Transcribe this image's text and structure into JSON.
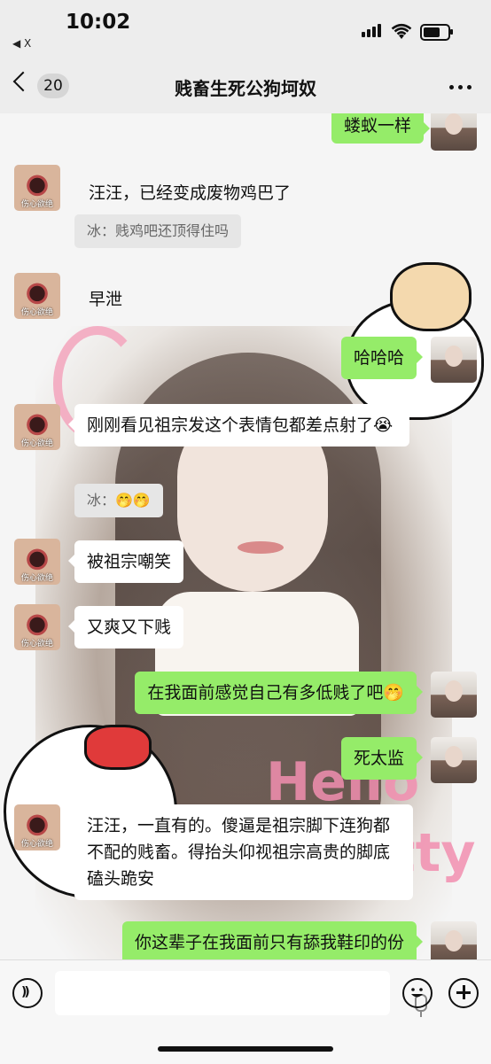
{
  "status_bar": {
    "time": "10:02",
    "back_app": "◀ X"
  },
  "nav": {
    "unread_count": "20",
    "title": "贱畜生死公狗坷奴"
  },
  "messages": [
    {
      "side": "out",
      "text": "蝼蚁一样"
    },
    {
      "side": "in",
      "text": "汪汪，已经变成废物鸡巴了"
    },
    {
      "side": "quote",
      "text": "冰：贱鸡吧还顶得住吗"
    },
    {
      "side": "in",
      "text": "早泄"
    },
    {
      "side": "out",
      "text": "哈哈哈"
    },
    {
      "side": "in",
      "text": "刚刚看见祖宗发这个表情包都差点射了😭"
    },
    {
      "side": "quote",
      "text": "冰：🤭🤭"
    },
    {
      "side": "in",
      "text": "被祖宗嘲笑"
    },
    {
      "side": "in",
      "text": "又爽又下贱"
    },
    {
      "side": "out",
      "text": "在我面前感觉自己有多低贱了吧🤭"
    },
    {
      "side": "out",
      "text": "死太监"
    },
    {
      "side": "in",
      "text": "汪汪，一直有的。傻逼是祖宗脚下连狗都不配的贱畜。得抬头仰视祖宗高贵的脚底磕头跪安"
    },
    {
      "side": "out",
      "text": "你这辈子在我面前只有舔我鞋印的份"
    }
  ],
  "peer_avatar_caption": "伤心欲绝",
  "background": {
    "hello_text": "Hello",
    "kitty_text": "tty"
  },
  "colors": {
    "outgoing_bubble": "#95ec69",
    "incoming_bubble": "#ffffff",
    "nav_bg": "#ededed"
  },
  "icons": [
    "back-chevron-icon",
    "more-icon",
    "voice-icon",
    "mic-icon",
    "emoji-icon",
    "plus-icon"
  ]
}
